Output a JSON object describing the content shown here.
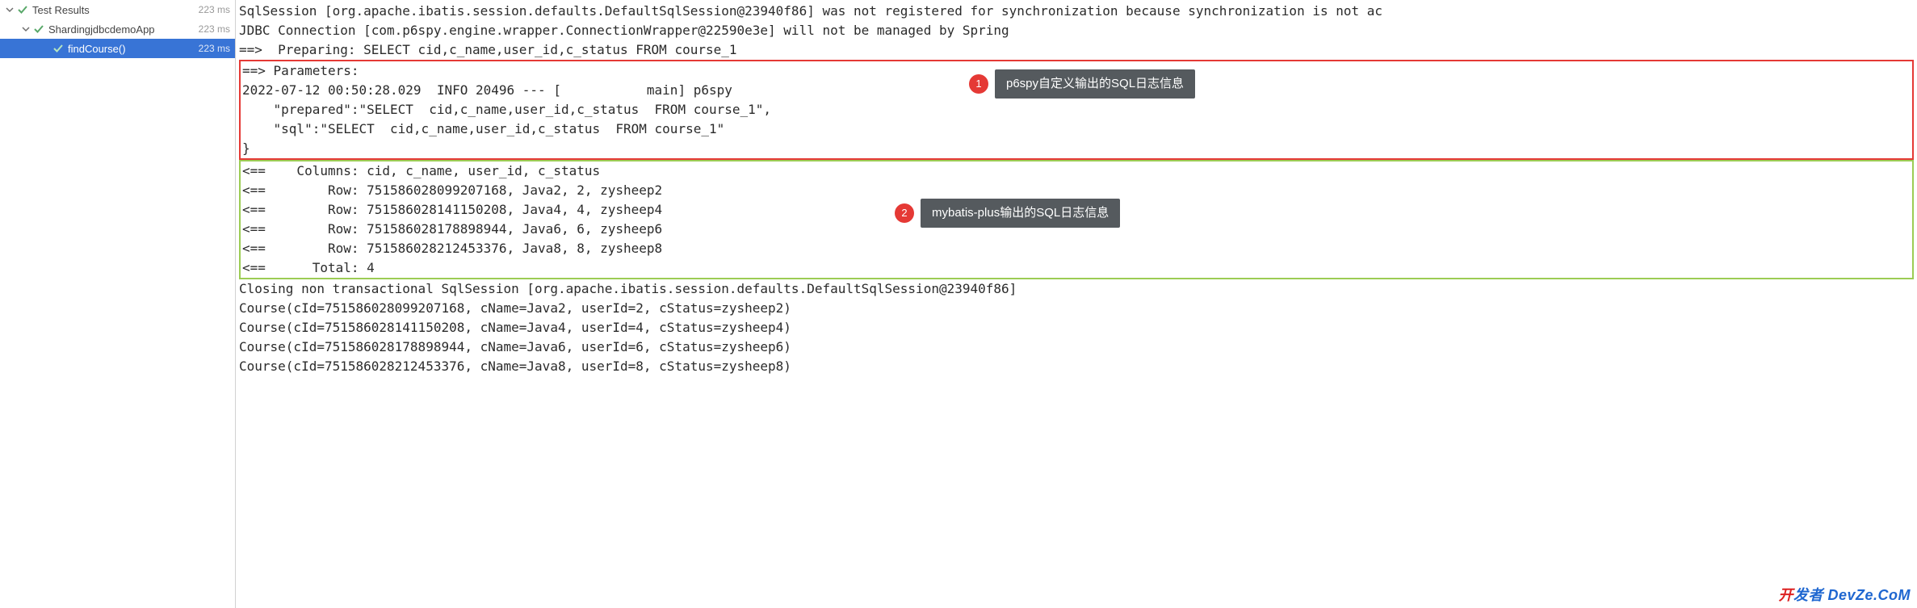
{
  "tree": {
    "root": {
      "label": "Test Results",
      "time": "223 ms"
    },
    "app": {
      "label": "ShardingjdbcdemoApp",
      "time": "223 ms"
    },
    "method": {
      "label": "findCourse()",
      "time": "223 ms"
    }
  },
  "console": {
    "l01": "SqlSession [org.apache.ibatis.session.defaults.DefaultSqlSession@23940f86] was not registered for synchronization because synchronization is not ac",
    "l02": "JDBC Connection [com.p6spy.engine.wrapper.ConnectionWrapper@22590e3e] will not be managed by Spring",
    "l03": "==>  Preparing: SELECT cid,c_name,user_id,c_status FROM course_1",
    "red": {
      "r1": "==> Parameters:",
      "r2": "2022-07-12 00:50:28.029  INFO 20496 --- [           main] p6spy                                                    : {",
      "r3": "    \"prepared\":\"SELECT  cid,c_name,user_id,c_status  FROM course_1\",",
      "r4": "    \"sql\":\"SELECT  cid,c_name,user_id,c_status  FROM course_1\"",
      "r5": "}"
    },
    "green": {
      "g1": "<==    Columns: cid, c_name, user_id, c_status",
      "g2": "<==        Row: 751586028099207168, Java2, 2, zysheep2",
      "g3": "<==        Row: 751586028141150208, Java4, 4, zysheep4",
      "g4": "<==        Row: 751586028178898944, Java6, 6, zysheep6",
      "g5": "<==        Row: 751586028212453376, Java8, 8, zysheep8",
      "g6": "<==      Total: 4"
    },
    "l20": "Closing non transactional SqlSession [org.apache.ibatis.session.defaults.DefaultSqlSession@23940f86]",
    "l21": "Course(cId=751586028099207168, cName=Java2, userId=2, cStatus=zysheep2)",
    "l22": "Course(cId=751586028141150208, cName=Java4, userId=4, cStatus=zysheep4)",
    "l23": "Course(cId=751586028178898944, cName=Java6, userId=6, cStatus=zysheep6)",
    "l24": "Course(cId=751586028212453376, cName=Java8, userId=8, cStatus=zysheep8)"
  },
  "callouts": {
    "c1": {
      "num": "1",
      "text": "p6spy自定义输出的SQL日志信息"
    },
    "c2": {
      "num": "2",
      "text": "mybatis-plus输出的SQL日志信息"
    }
  },
  "watermark": {
    "text_prefix": "开",
    "text_mid": "发者",
    "text_suffix": " DevZe.CoM"
  }
}
